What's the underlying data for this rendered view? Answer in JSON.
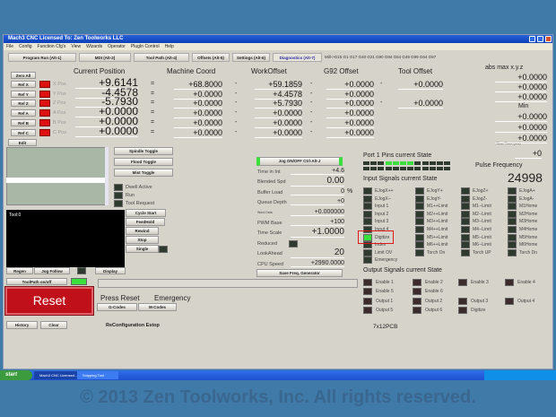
{
  "window": {
    "title": "Mach3 CNC  Licensed To:  Zen Toolworks LLC"
  },
  "menu": [
    "File",
    "Config",
    "Function Cfg's",
    "View",
    "Wizards",
    "Operator",
    "PlugIn Control",
    "Help"
  ],
  "tabs": [
    "Program Run (Alt-1)",
    "MDI (Alt-2)",
    "Tool Path (Alt-4)",
    "Offsets (Alt-5)",
    "Settings (Alt-6)",
    "Diagnostics (Alt-7)"
  ],
  "active_tab": "Diagnostics (Alt-7)",
  "gcode_modes": "Mill->G15  G1 G17 G40 G21 G90 G94 G54 G49 G99 G64 G97",
  "headers": {
    "current": "Current Position",
    "machine": "Machine Coord",
    "work": "WorkOffset",
    "g92": "G92 Offset",
    "tool": "Tool Offset",
    "absmax": "abs max x.y.z",
    "min": "Min",
    "slow": "Slow Time (ms)"
  },
  "zero_all": "Zero All",
  "axes": [
    {
      "ref": "Ref X",
      "name": "X Pos",
      "current": "+9.6141",
      "machine": "+68.8000",
      "work": "+59.1859",
      "g92": "+0.0000",
      "tool": "+0.0000"
    },
    {
      "ref": "Ref Y",
      "name": "Y Pos",
      "current": "-4.4578",
      "machine": "+0.0000",
      "work": "+4.4578",
      "g92": "+0.0000",
      "tool": ""
    },
    {
      "ref": "Ref Z",
      "name": "Z Pos",
      "current": "-5.7930",
      "machine": "+0.0000",
      "work": "+5.7930",
      "g92": "+0.0000",
      "tool": "+0.0000"
    },
    {
      "ref": "Ref A",
      "name": "A Pos",
      "current": "+0.0000",
      "machine": "+0.0000",
      "work": "+0.0000",
      "g92": "+0.0000",
      "tool": ""
    },
    {
      "ref": "Ref B",
      "name": "B Pos",
      "current": "+0.0000",
      "machine": "+0.0000",
      "work": "+0.0000",
      "g92": "+0.0000",
      "tool": ""
    },
    {
      "ref": "Ref C",
      "name": "C Pos",
      "current": "+0.0000",
      "machine": "+0.0000",
      "work": "+0.0000",
      "g92": "+0.0000",
      "tool": ""
    }
  ],
  "absmax": [
    "+0.0000",
    "+0.0000",
    "+0.0000"
  ],
  "min": [
    "+0.0000",
    "+0.0000",
    "+0.0000"
  ],
  "slow_time": "+0",
  "left": {
    "edit": "Edit",
    "spindle": "Spindle Toggle",
    "flood": "Flood Toggle",
    "mist": "Mist Toggle",
    "dwell": "Dwell Active",
    "run": "Run",
    "toolreq": "Tool Request",
    "tool_text": "Tool:0",
    "cycle": "Cycle Start",
    "feedhold": "FeedHold",
    "rewind": "Rewind",
    "stop": "Stop",
    "single": "Single",
    "regen": "Regen",
    "jogfollow": "Jog Follow",
    "display": "Display",
    "toolpath": "ToolPath on/off",
    "reset": "Reset",
    "press_reset": "Press Reset",
    "emergency": "Emergency",
    "gcodes": "G-Codes",
    "mcodes": "M-Codes",
    "history": "History",
    "clear": "Clear",
    "status": "ReConfiguration Estop"
  },
  "mid": {
    "jog": "Jog ON/OFF Ctrl-Alt-J",
    "save_freq": "Save Freq. Generator",
    "rows": [
      {
        "label": "Time in Int",
        "value": "+4.6"
      },
      {
        "label": "Blended Spd",
        "value": "0.00"
      },
      {
        "label": "Buffer Load",
        "value": "0",
        "unit": "%"
      },
      {
        "label": "Queue Depth",
        "value": "+0"
      },
      {
        "label": "Word Data",
        "value": "+0.000000"
      },
      {
        "label": "PWM Base",
        "value": "+100"
      },
      {
        "label": "Time Scale",
        "value": "+1.0000"
      },
      {
        "label": "Reduced",
        "value": ""
      },
      {
        "label": "LookAhead",
        "value": "20"
      },
      {
        "label": "CPU Speed",
        "value": "+2990.0000"
      }
    ]
  },
  "port": {
    "title": "Port 1 Pins current State",
    "row1": [
      0,
      0,
      0,
      1,
      1,
      1,
      1,
      0,
      0,
      0,
      0,
      0
    ],
    "row2": [
      0,
      0,
      0,
      0,
      0,
      0,
      0,
      0,
      0,
      0,
      0,
      0
    ]
  },
  "pulse": {
    "label": "Pulse Frequency",
    "value": "24998"
  },
  "inputs": {
    "title": "Input Signals current State",
    "cols": [
      [
        "EJogX++",
        "EJogX--",
        "Input 1",
        "Input 2",
        "Input 3",
        "Input 4",
        "Digitize",
        "Index",
        "Limit OV",
        "Emergency"
      ],
      [
        "EJogY+",
        "EJogY-",
        "M1++Limit",
        "M2++Limit",
        "M3++Limit",
        "M4++Limit",
        "M5++Limit",
        "M6++Limit",
        "Torch On"
      ],
      [
        "EJogZ+",
        "EJogZ-",
        "M1--Limit",
        "M2--Limit",
        "M3--Limit",
        "M4--Limit",
        "M5--Limit",
        "M6--Limit",
        "Torch UP"
      ],
      [
        "EJogA+",
        "EJogA-",
        "M1Home",
        "M2Home",
        "M3Home",
        "M4Home",
        "M5Home",
        "M6Home",
        "Torch Dn"
      ]
    ],
    "active": "Digitize"
  },
  "outputs": {
    "title": "Output Signals current State",
    "rows": [
      [
        "Enable 1",
        "Enable 2",
        "Enable 3",
        "Enable 4"
      ],
      [
        "Enable 5",
        "Enable 6"
      ],
      [
        "Output 1",
        "Output 2",
        "Output 3",
        "Output 4"
      ],
      [
        "Output 5",
        "Output 6",
        "Digitize"
      ]
    ]
  },
  "board": "7x12PCB",
  "taskbar": {
    "start": "start",
    "items": [
      "Mach3 CNC Licensed...",
      "Snipping Tool"
    ]
  },
  "watermark": "© 2013 Zen Toolworks, Inc. All rights reserved.",
  "colors": {
    "led_on": "#3ce03c",
    "led_ref": "#d11111",
    "reset": "#c0101a",
    "titlebar": "#0a3fb8"
  }
}
